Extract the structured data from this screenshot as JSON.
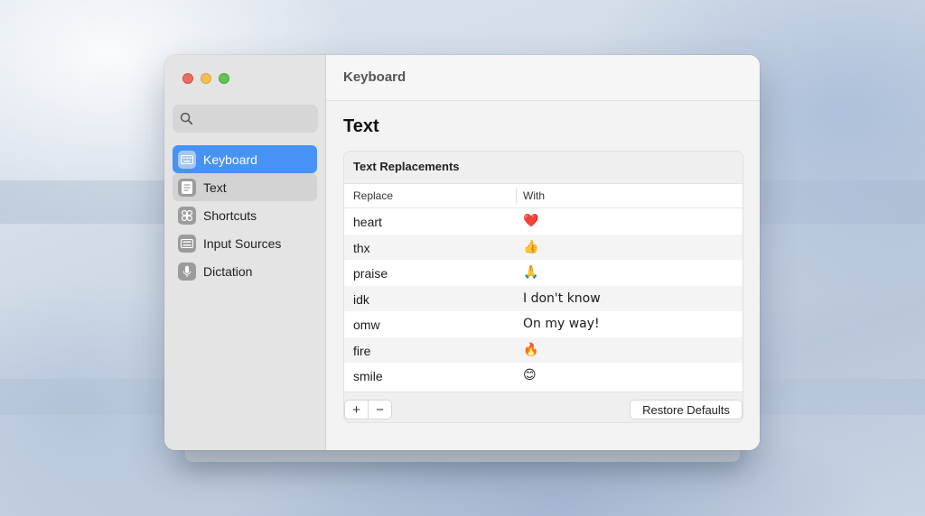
{
  "window": {
    "header_title": "Keyboard",
    "page_title": "Text"
  },
  "sidebar": {
    "search": {
      "placeholder": ""
    },
    "items": [
      {
        "label": "Keyboard",
        "icon": "keyboard-icon",
        "state": "active"
      },
      {
        "label": "Text",
        "icon": "text-icon",
        "state": "selected"
      },
      {
        "label": "Shortcuts",
        "icon": "shortcuts-icon",
        "state": "normal"
      },
      {
        "label": "Input Sources",
        "icon": "input-sources-icon",
        "state": "normal"
      },
      {
        "label": "Dictation",
        "icon": "microphone-icon",
        "state": "normal"
      }
    ]
  },
  "text_replacements": {
    "title": "Text Replacements",
    "columns": {
      "replace": "Replace",
      "with": "With"
    },
    "rows": [
      {
        "replace": "heart",
        "with": "❤️"
      },
      {
        "replace": "thx",
        "with": "👍"
      },
      {
        "replace": "praise",
        "with": "🙏"
      },
      {
        "replace": "idk",
        "with": "I don't know"
      },
      {
        "replace": "omw",
        "with": "On my way!"
      },
      {
        "replace": "fire",
        "with": "🔥"
      },
      {
        "replace": "smile",
        "with": "😊"
      }
    ],
    "add_label": "+",
    "remove_label": "−",
    "restore_label": "Restore Defaults"
  },
  "colors": {
    "accent": "#4792f5",
    "close": "#ed6a5e",
    "minimize": "#f4bf4f",
    "zoom": "#61c554"
  }
}
